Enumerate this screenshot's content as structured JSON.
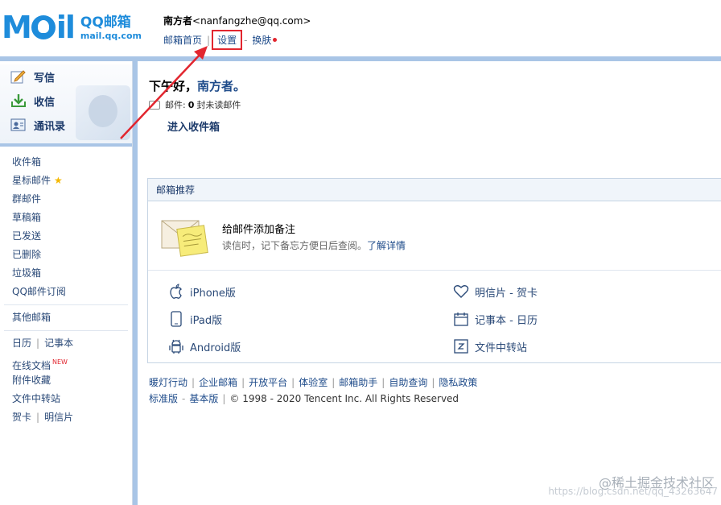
{
  "header": {
    "logo_cn": "QQ邮箱",
    "logo_url": "mail.qq.com",
    "user_name": "南方者",
    "user_email": "<nanfangzhe@qq.com>",
    "nav": {
      "home": "邮箱首页",
      "settings": "设置",
      "skin": "换肤"
    }
  },
  "sidebar": {
    "quick": [
      {
        "label": "写信",
        "icon": "pencil-icon"
      },
      {
        "label": "收信",
        "icon": "inbox-download-icon"
      },
      {
        "label": "通讯录",
        "icon": "contacts-icon"
      }
    ],
    "folders": [
      "收件箱",
      "星标邮件",
      "群邮件",
      "草稿箱",
      "已发送",
      "已删除",
      "垃圾箱",
      "QQ邮件订阅"
    ],
    "other": "其他邮箱",
    "tools": {
      "calendar": "日历",
      "notebook": "记事本",
      "docs": "在线文档",
      "new_tag": "NEW",
      "attachments": "附件收藏",
      "transfer": "文件中转站",
      "card": "贺卡",
      "postcard": "明信片"
    }
  },
  "main": {
    "greeting": "下午好，",
    "greeting_name": "南方者。",
    "mail_label": "邮件:",
    "unread_count": "0",
    "unread_text": "封未读邮件",
    "enter_inbox": "进入收件箱",
    "rec_title": "邮箱推荐",
    "feature_title": "给邮件添加备注",
    "feature_desc": "读信时，记下备忘方便日后查阅。",
    "feature_link": "了解详情",
    "apps": {
      "iphone": "iPhone版",
      "ipad": "iPad版",
      "android": "Android版",
      "postcard": "明信片 - 贺卡",
      "notebook": "记事本 - 日历",
      "transfer": "文件中转站"
    }
  },
  "footer": {
    "links": [
      "暖灯行动",
      "企业邮箱",
      "开放平台",
      "体验室",
      "邮箱助手",
      "自助查询",
      "隐私政策"
    ],
    "standard": "标准版",
    "basic": "基本版",
    "copyright": "© 1998 - 2020 Tencent Inc. All Rights Reserved"
  },
  "watermark": {
    "text": "@稀土掘金技术社区",
    "url": "https://blog.csdn.net/qq_43263647"
  },
  "colors": {
    "accent": "#1e8cdb",
    "bar": "#a9c5e6",
    "annotation": "#e2262f"
  }
}
